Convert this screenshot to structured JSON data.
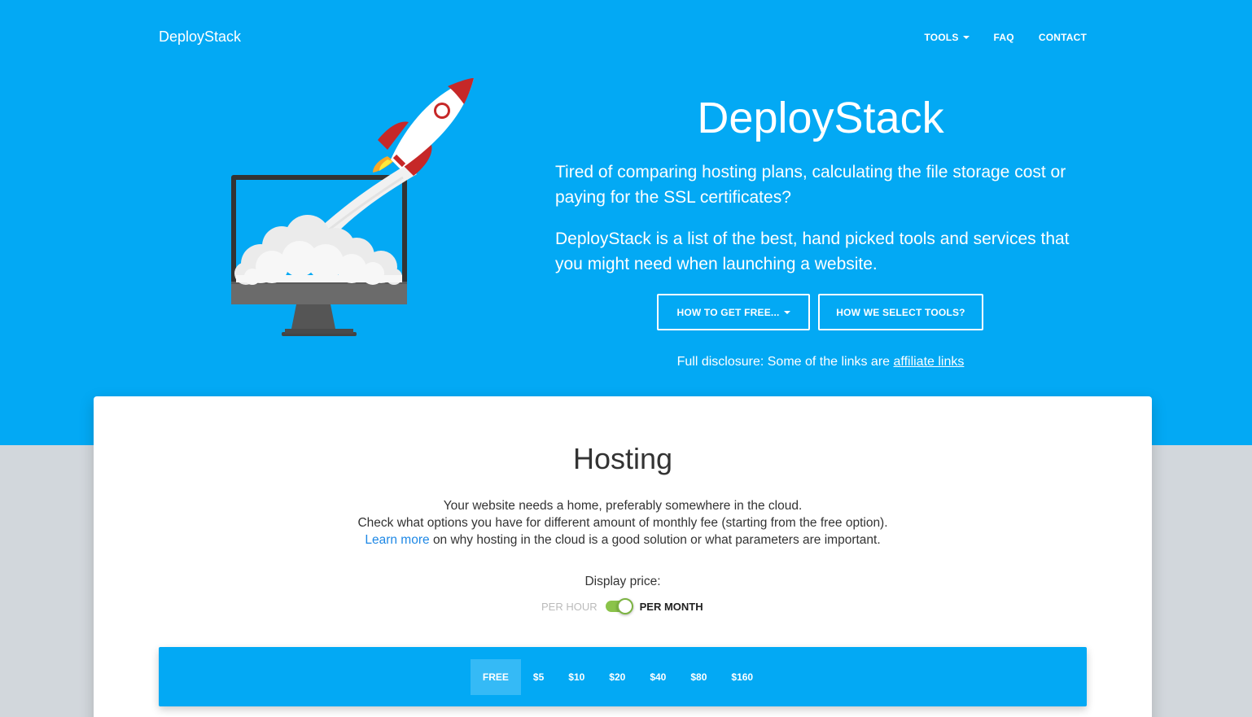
{
  "nav": {
    "brand": "DeployStack",
    "tools": "TOOLS",
    "faq": "FAQ",
    "contact": "CONTACT"
  },
  "hero": {
    "title": "DeployStack",
    "paragraph1": "Tired of comparing hosting plans, calculating the file storage cost or paying for the SSL certificates?",
    "paragraph2": "DeployStack is a list of the best, hand picked tools and services that you might need when launching a website.",
    "button_free": "HOW TO GET FREE...",
    "button_select": "HOW WE SELECT TOOLS?",
    "disclosure_text": "Full disclosure: Some of the links are",
    "disclosure_link": "affiliate links"
  },
  "hosting": {
    "title": "Hosting",
    "line1": "Your website needs a home, preferably somewhere in the cloud.",
    "line2": "Check what options you have for different amount of monthly fee (starting from the free option).",
    "learn_more": "Learn more",
    "line3_rest": "on why hosting in the cloud is a good solution or what parameters are important.",
    "display_price_label": "Display price:",
    "toggle_off_label": "PER HOUR",
    "toggle_on_label": "PER MONTH",
    "toggle_state": "per-month",
    "price_tabs": [
      "FREE",
      "$5",
      "$10",
      "$20",
      "$40",
      "$80",
      "$160"
    ],
    "active_tab": "FREE"
  },
  "colors": {
    "primary": "#03a9f4",
    "toggle_green": "#8bc34a",
    "link": "#1e88e5",
    "page_bg": "#d2d7dc"
  }
}
